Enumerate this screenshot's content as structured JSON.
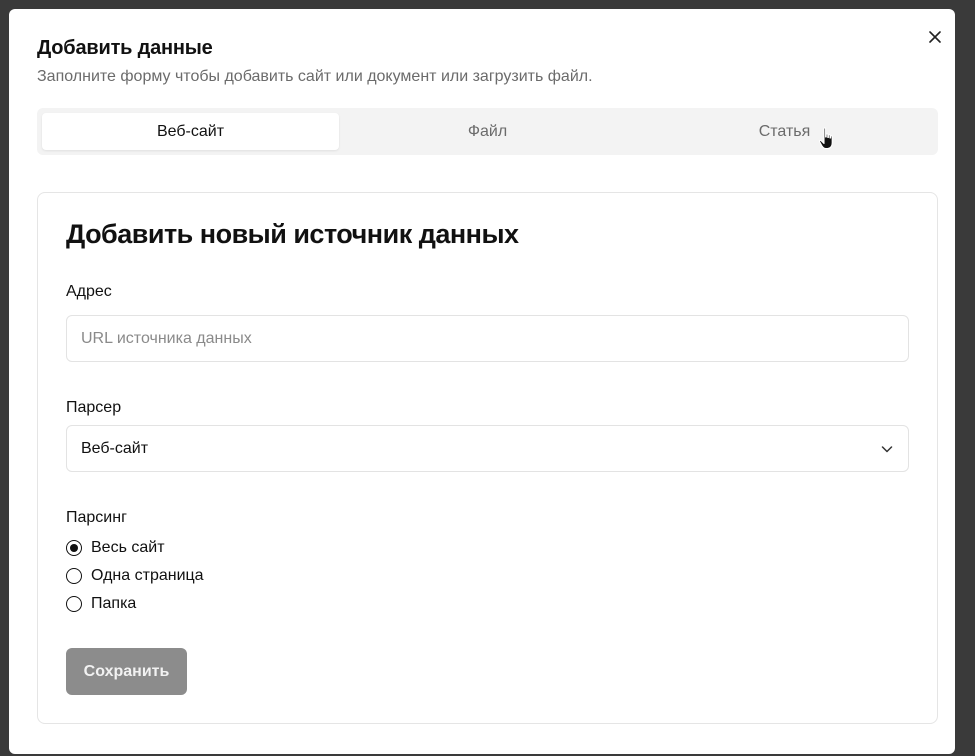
{
  "dialog": {
    "title": "Добавить данные",
    "subtitle": "Заполните форму чтобы добавить сайт или документ или загрузить файл.",
    "close_icon": "close-icon"
  },
  "tabs": [
    {
      "label": "Веб-сайт",
      "active": true
    },
    {
      "label": "Файл",
      "active": false
    },
    {
      "label": "Статья",
      "active": false
    }
  ],
  "form": {
    "title": "Добавить новый источник данных",
    "address": {
      "label": "Адрес",
      "value": "",
      "placeholder": "URL источника данных"
    },
    "parser": {
      "label": "Парсер",
      "selected": "Веб-сайт",
      "icon": "chevron-down-icon"
    },
    "parsing": {
      "label": "Парсинг",
      "options": [
        {
          "label": "Весь сайт",
          "checked": true
        },
        {
          "label": "Одна страница",
          "checked": false
        },
        {
          "label": "Папка",
          "checked": false
        }
      ]
    },
    "save_label": "Сохранить"
  },
  "colors": {
    "overlay": "#3a3a3a",
    "tabs_background": "#f3f3f3",
    "save_button_disabled": "#8c8c8c",
    "muted_text": "#6b6b6b"
  }
}
